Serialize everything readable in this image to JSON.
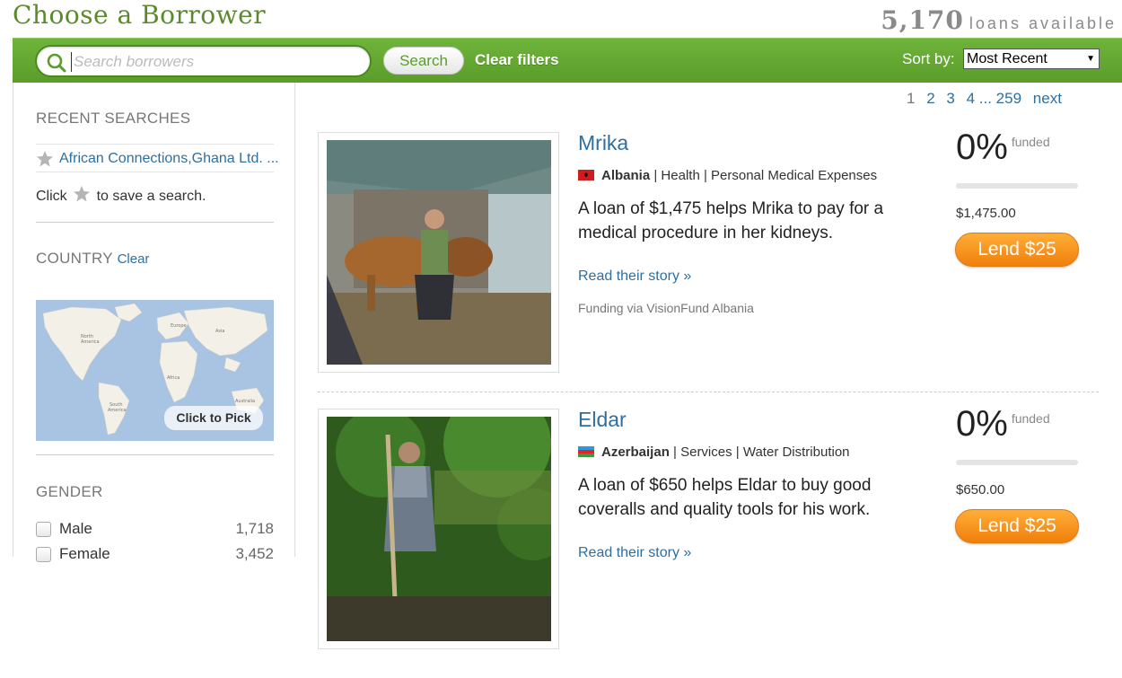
{
  "header": {
    "title": "Choose a Borrower",
    "loans_count": "5,170",
    "loans_label": "loans available"
  },
  "toolbar": {
    "search_placeholder": "Search borrowers",
    "search_button": "Search",
    "clear_filters": "Clear filters",
    "sort_label": "Sort by:",
    "sort_value": "Most Recent"
  },
  "sidebar": {
    "recent_searches_heading": "RECENT SEARCHES",
    "recent_search_item": "African Connections,Ghana Ltd. ...",
    "save_hint_prefix": "Click",
    "save_hint_suffix": "to save a search.",
    "country_heading": "COUNTRY",
    "country_clear": "Clear",
    "map_button": "Click to Pick",
    "gender_heading": "GENDER",
    "gender_options": [
      {
        "label": "Male",
        "count": "1,718"
      },
      {
        "label": "Female",
        "count": "3,452"
      }
    ]
  },
  "pagination": {
    "pages": [
      "1",
      "2",
      "3",
      "4 ... 259"
    ],
    "current": "1",
    "next": "next"
  },
  "loans": [
    {
      "name": "Mrika",
      "country": "Albania",
      "sector": "Health",
      "activity": "Personal Medical Expenses",
      "description": "A loan of $1,475 helps Mrika to pay for a medical procedure in her kidneys.",
      "story_link": "Read their story »",
      "partner": "Funding via VisionFund Albania",
      "funded_pct": "0%",
      "funded_label": "funded",
      "funded_fraction": 0,
      "amount": "$1,475.00",
      "lend_button": "Lend $25"
    },
    {
      "name": "Eldar",
      "country": "Azerbaijan",
      "sector": "Services",
      "activity": "Water Distribution",
      "description": "A loan of $650 helps Eldar to buy good coveralls and quality tools for his work.",
      "story_link": "Read their story »",
      "funded_pct": "0%",
      "funded_label": "funded",
      "funded_fraction": 0,
      "amount": "$650.00",
      "lend_button": "Lend $25"
    }
  ],
  "colors": {
    "brand_green": "#5a9e2a",
    "link_blue": "#2f6fa0",
    "lend_orange": "#f28a12"
  }
}
